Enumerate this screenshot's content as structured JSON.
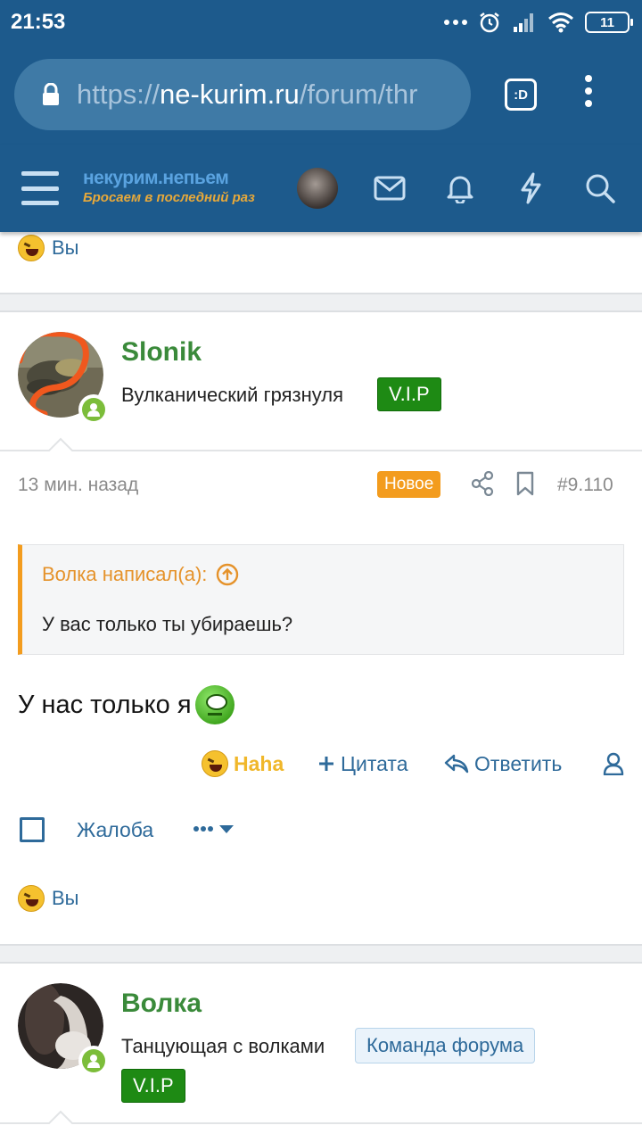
{
  "status_bar": {
    "time": "21:53",
    "battery": "11"
  },
  "browser": {
    "url_prefix": "https://",
    "url_host": "ne-kurim.ru",
    "url_path": "/forum/thr",
    "tab_label": ":D"
  },
  "site": {
    "logo_line1": "некурим.непьем",
    "logo_line2": "Бросаем в последний раз"
  },
  "top_reaction": {
    "text": "Вы"
  },
  "post": {
    "username": "Slonik",
    "user_title": "Вулканический грязнуля",
    "badge": "V.I.P",
    "time": "13 мин. назад",
    "new_label": "Новое",
    "number": "#9.110",
    "quote_author": "Волка написал(а):",
    "quote_text": "У вас только ты убираешь?",
    "body": "У нас только я",
    "actions": {
      "haha": "Haha",
      "quote": "Цитата",
      "reply": "Ответить"
    },
    "report": "Жалоба",
    "reaction_text": "Вы"
  },
  "next_post": {
    "username": "Волка",
    "user_title": "Танцующая с волками",
    "team_badge": "Команда форума",
    "badge": "V.I.P"
  },
  "colors": {
    "header_bg": "#1d5a8c",
    "username": "#3a8a3a",
    "link": "#2e6a9a",
    "accent": "#f39c1e",
    "vip_bg": "#1e8a14"
  }
}
